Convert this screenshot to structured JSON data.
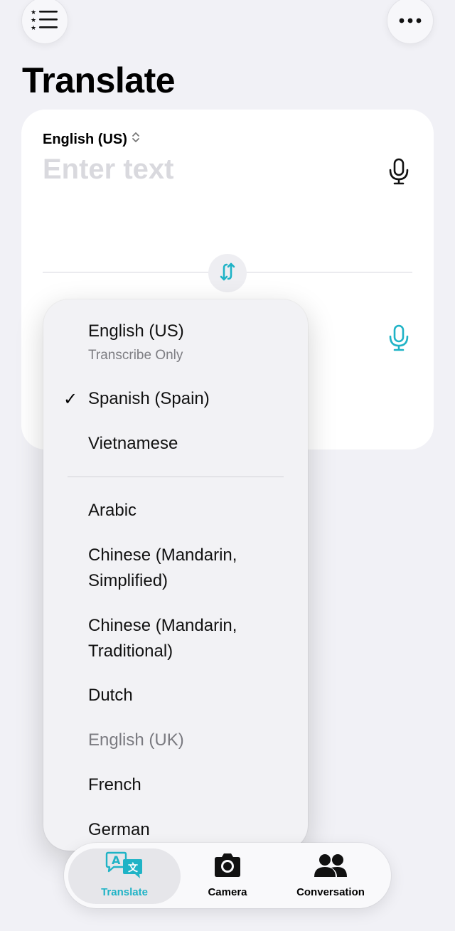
{
  "header": {
    "title": "Translate",
    "list_icon": "list-star-icon",
    "more_icon": "ellipsis-icon"
  },
  "input_card": {
    "source_language": "English (US)",
    "placeholder": "Enter text",
    "mic_icon": "microphone-icon",
    "swap_icon": "swap-arrows-icon",
    "accent_color": "#1fb3c6"
  },
  "language_menu": {
    "recent": [
      {
        "label": "English (US)",
        "sublabel": "Transcribe Only",
        "checked": false
      },
      {
        "label": "Spanish (Spain)",
        "checked": true
      },
      {
        "label": "Vietnamese",
        "checked": false
      }
    ],
    "all": [
      {
        "label": "Arabic"
      },
      {
        "label": "Chinese (Mandarin, Simplified)"
      },
      {
        "label": "Chinese (Mandarin, Traditional)"
      },
      {
        "label": "Dutch"
      },
      {
        "label": "English (UK)",
        "dimmed": true
      },
      {
        "label": "French"
      },
      {
        "label": "German"
      }
    ],
    "check_mark": "✓"
  },
  "tab_bar": {
    "tabs": [
      {
        "label": "Translate",
        "icon": "translate-bubbles-icon",
        "active": true
      },
      {
        "label": "Camera",
        "icon": "camera-icon",
        "active": false
      },
      {
        "label": "Conversation",
        "icon": "people-icon",
        "active": false
      }
    ]
  }
}
